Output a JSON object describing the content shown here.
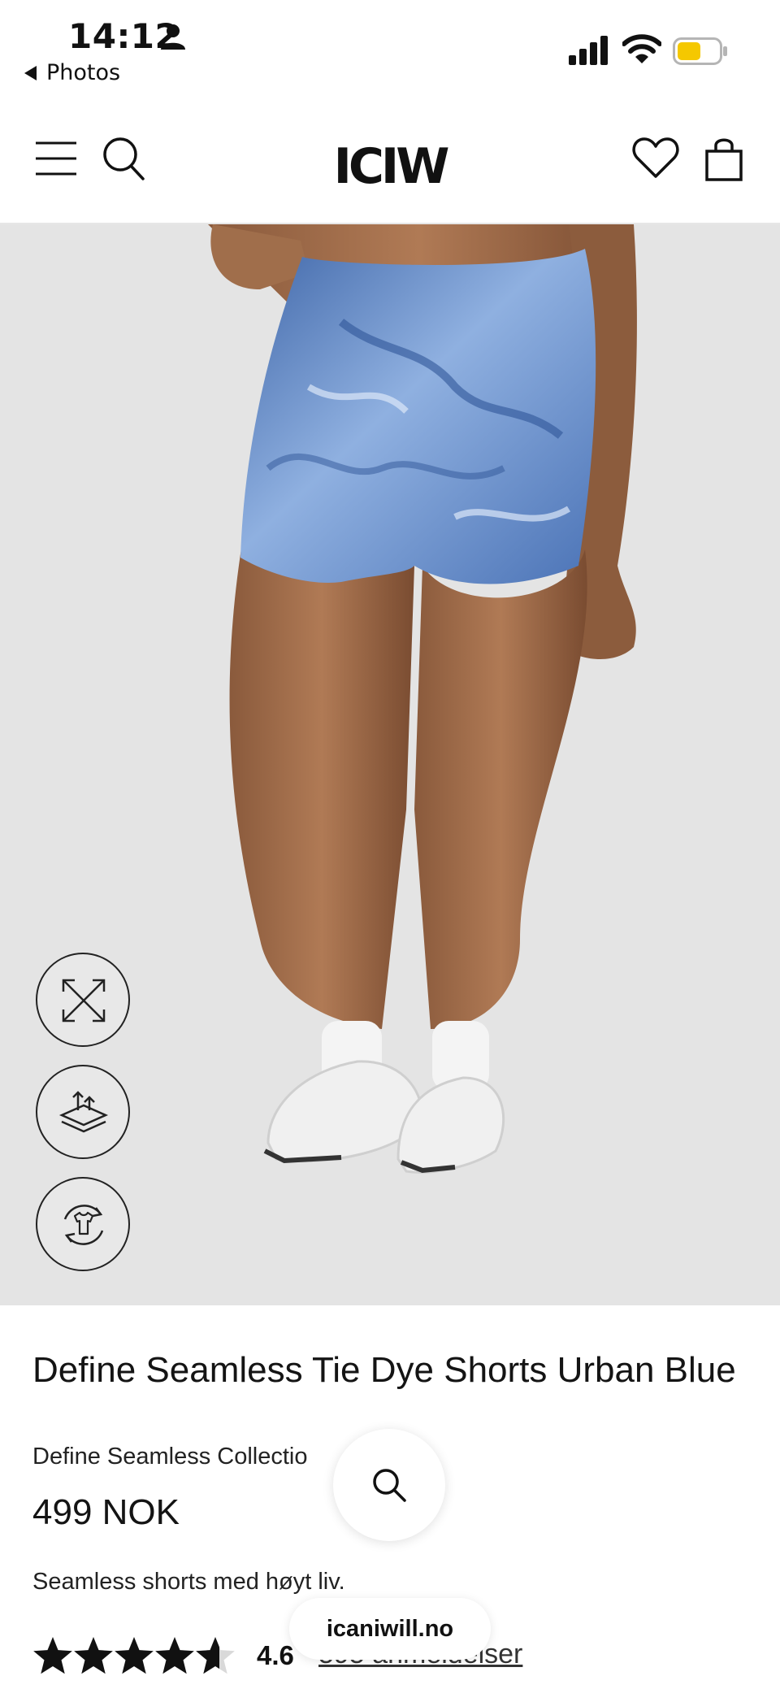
{
  "status_bar": {
    "time": "14:12",
    "back_label": "Photos",
    "person_icon": "person-icon",
    "signal_icon": "cellular-signal-icon",
    "wifi_icon": "wifi-icon",
    "battery_icon": "battery-icon",
    "battery_color": "#f5c800"
  },
  "nav": {
    "logo": "ICIW",
    "menu_icon": "hamburger-menu-icon",
    "search_icon": "search-icon",
    "wishlist_icon": "heart-icon",
    "bag_icon": "shopping-bag-icon"
  },
  "hero": {
    "background": "#e4e4e4",
    "image_description_icon": "product-photo",
    "actions": [
      {
        "icon": "expand-icon"
      },
      {
        "icon": "fabric-layers-icon"
      },
      {
        "icon": "rotate-garment-icon"
      }
    ]
  },
  "product": {
    "title": "Define Seamless Tie Dye Shorts Urban Blue",
    "collection": "Define Seamless Collectio",
    "price": "499 NOK",
    "description": "Seamless shorts med høyt liv.",
    "rating": {
      "stars_filled": 4.6,
      "stars_total": 5,
      "value": "4.6",
      "reviews_label": "595 anmeldelser"
    }
  },
  "overlay": {
    "float_search_icon": "search-icon",
    "url": "icaniwill.no"
  }
}
